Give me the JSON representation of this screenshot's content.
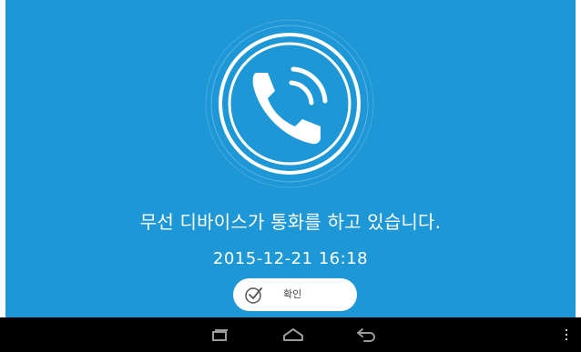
{
  "dialog": {
    "message": "무선 디바이스가 통화를 하고 있습니다.",
    "datetime": "2015-12-21 16:18",
    "confirm_label": "확인",
    "confirm_icon": "check-circle-icon",
    "call_icon": "phone-call-icon"
  },
  "navbar": {
    "buttons": [
      "recent-apps-icon",
      "home-icon",
      "back-icon",
      "overflow-menu-icon"
    ]
  },
  "colors": {
    "background": "#1e97d6",
    "foreground": "#ffffff",
    "navbar": "#000000"
  }
}
